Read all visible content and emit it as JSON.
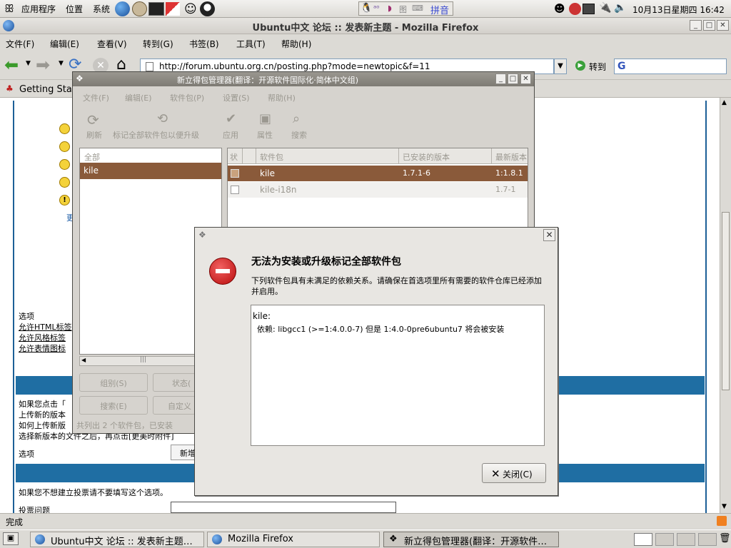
{
  "top_panel": {
    "menus": [
      "应用程序",
      "位置",
      "系统"
    ],
    "input_method": "拼音",
    "clock": "10月13日星期四 16:42"
  },
  "firefox": {
    "window_title": "Ubuntu中文 论坛 :: 发表新主题 - Mozilla Firefox",
    "menu": [
      "文件(F)",
      "编辑(E)",
      "查看(V)",
      "转到(G)",
      "书签(B)",
      "工具(T)",
      "帮助(H)"
    ],
    "url": "http://forum.ubuntu.org.cn/posting.php?mode=newtopic&f=11",
    "go_label": "转到",
    "bookmark": "Getting Sta",
    "status": "完成"
  },
  "page": {
    "options_label": "选项",
    "options": [
      "允许HTML标签",
      "允许风格标签",
      "允许表情图标"
    ],
    "partial_more": "更",
    "info_lines": [
      "如果您点击「",
      "上传新的版本",
      "如何上传新版",
      "选择新版本的文件之后，再点击[更美时附件]"
    ],
    "options_label2": "选项",
    "new_label": "新增",
    "poll_note": "如果您不想建立投票请不要填写这个选项。",
    "poll_question": "投票问题"
  },
  "synaptic": {
    "title": "新立得包管理器(翻译：开源软件国际化·简体中文组)",
    "menu": [
      "文件(F)",
      "编辑(E)",
      "软件包(P)",
      "设置(S)",
      "帮助(H)"
    ],
    "toolbar": [
      "刷新",
      "标记全部软件包以便升级",
      "应用",
      "属性",
      "搜索"
    ],
    "filter_all": "全部",
    "filter_selected": "kile",
    "columns": [
      "状",
      "",
      "软件包",
      "已安装的版本",
      "最新版本"
    ],
    "packages": [
      {
        "name": "kile",
        "installed": "1.7.1-6",
        "latest": "1:1.8.1"
      },
      {
        "name": "kile-i18n",
        "installed": "",
        "latest": "1.7-1"
      }
    ],
    "buttons": [
      "组别(S)",
      "状态(",
      "搜索(E)",
      "自定义"
    ],
    "status": "共列出 2 个软件包，已安装"
  },
  "dialog": {
    "heading": "无法为安装或升级标记全部软件包",
    "message": "下列软件包具有未满足的依赖关系。请确保在首选项里所有需要的软件仓库已经添加并启用。",
    "detail_pkg": "kile:",
    "detail_dep": "依赖: libgcc1 (>=1:4.0.0-7) 但是 1:4.0-0pre6ubuntu7 将会被安装",
    "close_label": "关闭(C)"
  },
  "taskbar": [
    "Ubuntu中文 论坛 :: 发表新主题…",
    "Mozilla Firefox",
    "新立得包管理器(翻译：开源软件…"
  ]
}
